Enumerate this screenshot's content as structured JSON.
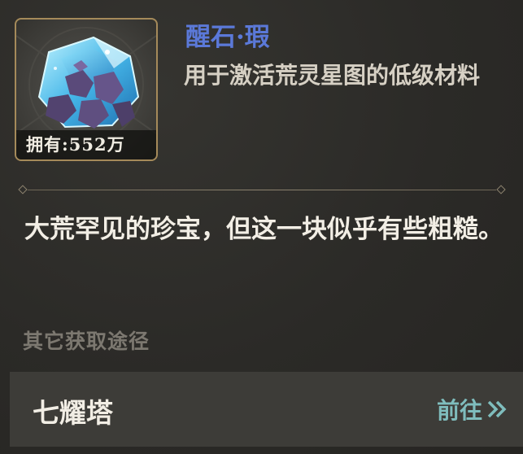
{
  "item": {
    "name": "醒石·瑕",
    "subtitle": "用于激活荒灵星图的低级材料",
    "owned_label": "拥有:552万",
    "icon": "crystal-ore-icon"
  },
  "description": "大荒罕见的珍宝，但这一块似乎有些粗糙。",
  "other_sources": {
    "title": "其它获取途径",
    "items": [
      {
        "name": "七耀塔",
        "action_label": "前往",
        "action_icon": "double-chevron-right-icon"
      }
    ]
  },
  "colors": {
    "name": "#5b79d9",
    "action": "#7fbdbd",
    "frame": "#a58a5a",
    "background": "#2b2a27"
  }
}
